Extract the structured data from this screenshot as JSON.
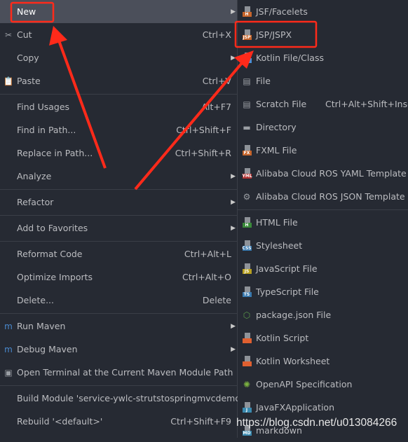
{
  "left_menu": [
    {
      "label": "New",
      "arrow": true,
      "highlighted": true
    },
    {
      "label": "Cut",
      "shortcut": "Ctrl+X",
      "icon": "scissors-icon"
    },
    {
      "label": "Copy",
      "arrow": true
    },
    {
      "label": "Paste",
      "shortcut": "Ctrl+V",
      "icon": "clipboard-icon"
    },
    {
      "sep": true
    },
    {
      "label": "Find Usages",
      "shortcut": "Alt+F7"
    },
    {
      "label": "Find in Path...",
      "shortcut": "Ctrl+Shift+F"
    },
    {
      "label": "Replace in Path...",
      "shortcut": "Ctrl+Shift+R"
    },
    {
      "label": "Analyze",
      "arrow": true
    },
    {
      "sep": true
    },
    {
      "label": "Refactor",
      "arrow": true
    },
    {
      "sep": true
    },
    {
      "label": "Add to Favorites",
      "arrow": true
    },
    {
      "sep": true
    },
    {
      "label": "Reformat Code",
      "shortcut": "Ctrl+Alt+L"
    },
    {
      "label": "Optimize Imports",
      "shortcut": "Ctrl+Alt+O"
    },
    {
      "label": "Delete...",
      "shortcut": "Delete"
    },
    {
      "sep": true
    },
    {
      "label": "Run Maven",
      "arrow": true,
      "icon": "maven-icon"
    },
    {
      "label": "Debug Maven",
      "arrow": true,
      "icon": "maven-icon"
    },
    {
      "label": "Open Terminal at the Current Maven Module Path",
      "icon": "terminal-icon"
    },
    {
      "sep": true
    },
    {
      "label": "Build Module 'service-ywlc-strutstospringmvcdemo'"
    },
    {
      "label": "Rebuild '<default>'",
      "shortcut": "Ctrl+Shift+F9"
    }
  ],
  "right_menu": [
    {
      "label": "JSF/Facelets",
      "icon": "jsf-file-icon",
      "badge": "H",
      "color": "#c7652b"
    },
    {
      "label": "JSP/JSPX",
      "icon": "jsp-file-icon",
      "badge": "JSP",
      "color": "#c7652b"
    },
    {
      "label": "Kotlin File/Class",
      "icon": "kotlin-file-icon",
      "color": "#4a90d9"
    },
    {
      "label": "File",
      "icon": "file-icon"
    },
    {
      "label": "Scratch File",
      "shortcut": "Ctrl+Alt+Shift+Insert",
      "icon": "scratch-file-icon"
    },
    {
      "label": "Directory",
      "icon": "folder-icon"
    },
    {
      "label": "FXML File",
      "icon": "fxml-file-icon",
      "badge": "FX",
      "color": "#c7652b"
    },
    {
      "label": "Alibaba Cloud ROS YAML Template",
      "icon": "yaml-file-icon",
      "badge": "YML",
      "color": "#b03030"
    },
    {
      "label": "Alibaba Cloud ROS JSON Template",
      "icon": "json-template-icon"
    },
    {
      "sep": true
    },
    {
      "label": "HTML File",
      "icon": "html-file-icon",
      "badge": "H",
      "color": "#3a8a3a"
    },
    {
      "label": "Stylesheet",
      "icon": "css-file-icon",
      "badge": "CSS",
      "color": "#3a7ab0"
    },
    {
      "label": "JavaScript File",
      "icon": "js-file-icon",
      "badge": "JS",
      "color": "#b8a020"
    },
    {
      "label": "TypeScript File",
      "icon": "ts-file-icon",
      "badge": "TS",
      "color": "#3a7ab0"
    },
    {
      "label": "package.json File",
      "icon": "nodejs-icon"
    },
    {
      "label": "Kotlin Script",
      "icon": "kotlin-script-icon",
      "color": "#e06030"
    },
    {
      "label": "Kotlin Worksheet",
      "icon": "kotlin-worksheet-icon",
      "color": "#e06030"
    },
    {
      "label": "OpenAPI Specification",
      "icon": "openapi-icon"
    },
    {
      "label": "JavaFXApplication",
      "icon": "javafx-file-icon",
      "badge": "J",
      "color": "#3a8ab0"
    },
    {
      "label": "markdown",
      "icon": "markdown-file-icon",
      "badge": "MD",
      "color": "#3a8ab0"
    }
  ],
  "watermark": "https://blog.csdn.net/u013084266",
  "colors": {
    "background": "#262a33",
    "highlight": "#4b4f5a",
    "annotation": "#ff2a1a"
  }
}
